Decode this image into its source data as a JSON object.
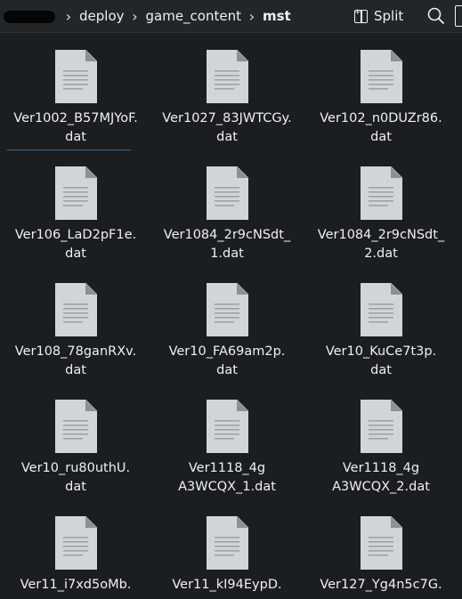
{
  "breadcrumb": {
    "items": [
      "deploy",
      "game_content",
      "mst"
    ]
  },
  "toolbar": {
    "split_label": "Split",
    "split_icon": "split-view-icon",
    "search_icon": "search-icon"
  },
  "files": [
    {
      "line1": "Ver1002_B57MJYoF.",
      "line2": "dat"
    },
    {
      "line1": "Ver1027_83JWTCGy.",
      "line2": "dat"
    },
    {
      "line1": "Ver102_n0DUZr86.",
      "line2": "dat"
    },
    {
      "line1": "Ver106_LaD2pF1e.",
      "line2": "dat"
    },
    {
      "line1": "Ver1084_2r9cNSdt_",
      "line2": "1.dat"
    },
    {
      "line1": "Ver1084_2r9cNSdt_",
      "line2": "2.dat"
    },
    {
      "line1": "Ver108_78ganRXv.",
      "line2": "dat"
    },
    {
      "line1": "Ver10_FA69am2p.",
      "line2": "dat"
    },
    {
      "line1": "Ver10_KuCe7t3p.",
      "line2": "dat"
    },
    {
      "line1": "Ver10_ru80uthU.",
      "line2": "dat"
    },
    {
      "line1": "Ver1118_4g",
      "line2": "A3WCQX_1.dat"
    },
    {
      "line1": "Ver1118_4g",
      "line2": "A3WCQX_2.dat"
    },
    {
      "line1": "Ver11_i7xd5oMb.",
      "line2": ""
    },
    {
      "line1": "Ver11_kI94EypD.",
      "line2": ""
    },
    {
      "line1": "Ver127_Yg4n5c7G.",
      "line2": ""
    }
  ]
}
